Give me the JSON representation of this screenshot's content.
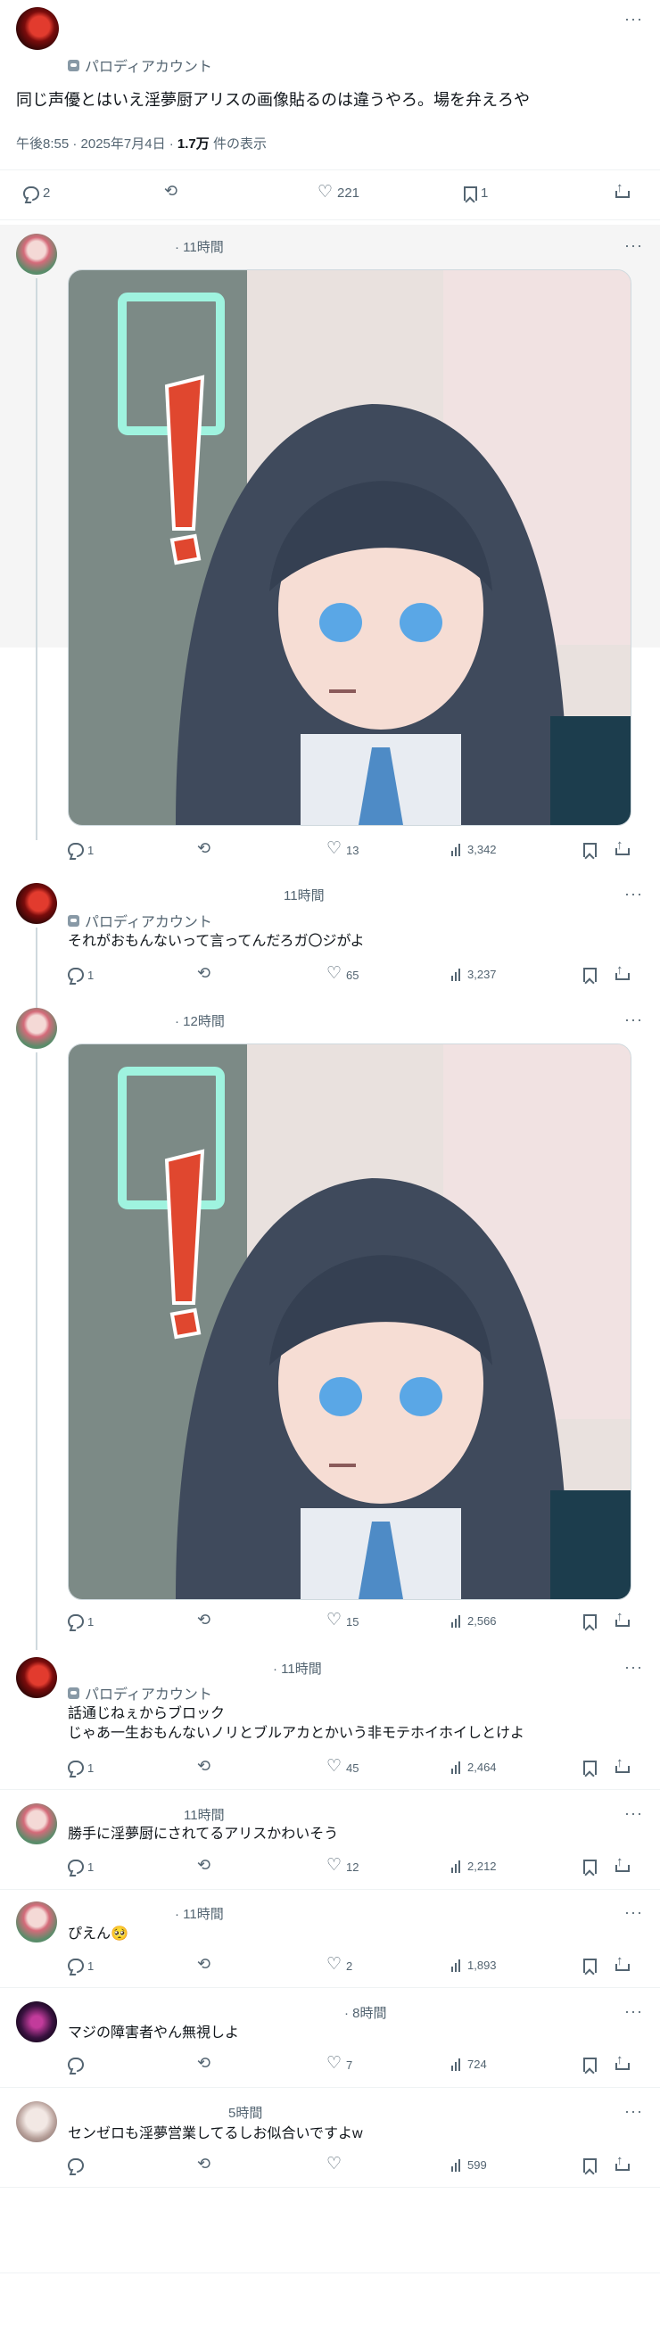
{
  "main_tweet": {
    "account_label": "パロディアカウント",
    "text": "同じ声優とはいえ淫夢厨アリスの画像貼るのは違うやろ。場を弁えろや",
    "timestamp": "午後8:55 · 2025年7月4日 · ",
    "views_count": "1.7万",
    "views_label": " 件の表示",
    "replies": "2",
    "likes": "221",
    "bookmarks": "1"
  },
  "replies": [
    {
      "time": "· 11時間",
      "text": "",
      "replies": "1",
      "likes": "13",
      "views": "3,342"
    },
    {
      "time": "11時間",
      "account_label": "パロディアカウント",
      "text": "それがおもんないって言ってんだろガ〇ジがよ",
      "replies": "1",
      "likes": "65",
      "views": "3,237"
    },
    {
      "time": "· 12時間",
      "text": "",
      "replies": "1",
      "likes": "15",
      "views": "2,566"
    },
    {
      "time": "· 11時間",
      "account_label": "パロディアカウント",
      "text": "話通じねぇからブロック\nじゃあ一生おもんないノリとブルアカとかいう非モテホイホイしとけよ",
      "replies": "1",
      "likes": "45",
      "views": "2,464"
    },
    {
      "time": "11時間",
      "text": "勝手に淫夢厨にされてるアリスかわいそう",
      "replies": "1",
      "likes": "12",
      "views": "2,212"
    },
    {
      "time": "· 11時間",
      "text": "ぴえん🥺",
      "replies": "1",
      "likes": "2",
      "views": "1,893"
    },
    {
      "time": "· 8時間",
      "text": "マジの障害者やん無視しよ",
      "replies": "",
      "likes": "7",
      "views": "724"
    },
    {
      "time": "5時間",
      "text": "センゼロも淫夢営業してるしお似合いですよw",
      "replies": "",
      "likes": "",
      "views": "599"
    }
  ],
  "media_description_none": "",
  "colors": {
    "text": "#0f1419",
    "muted": "#536471",
    "border": "#eff3f4",
    "accent": "#e0472f"
  }
}
